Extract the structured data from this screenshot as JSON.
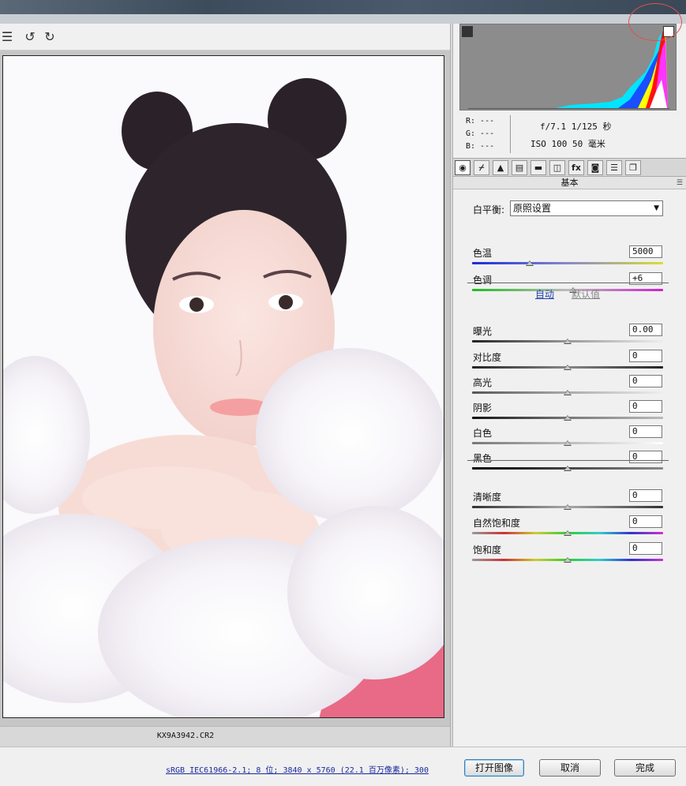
{
  "toolbar": {
    "icons": [
      "list-icon",
      "rotate-left-icon",
      "rotate-right-icon"
    ]
  },
  "image": {
    "filename": "KX9A3942.CR2"
  },
  "readout": {
    "r": "R:  ---",
    "g": "G:  ---",
    "b": "B:  ---",
    "aperture_shutter": "f/7.1  1/125 秒",
    "iso_focal": "ISO 100  50 毫米"
  },
  "tabs": [
    "基本",
    "色调曲线",
    "细节",
    "HSL",
    "分离色调",
    "镜头校正",
    "效果",
    "相机校准",
    "预设",
    "快照"
  ],
  "tab_glyphs": [
    "◉",
    "⌿",
    "▲",
    "▤",
    "▬",
    "◫",
    "fx",
    "◙",
    "☰",
    "❐"
  ],
  "panel": {
    "section_title": "基本",
    "white_balance": {
      "label": "白平衡:",
      "value": "原照设置"
    },
    "auto_link": "自动",
    "default_link": "默认值",
    "sliders": [
      {
        "label": "色温",
        "value": "5000",
        "fill": 0.3
      },
      {
        "label": "色调",
        "value": "+6",
        "fill": 0.53
      },
      {
        "label": "曝光",
        "value": "0.00",
        "fill": 0.5
      },
      {
        "label": "对比度",
        "value": "0",
        "fill": 0.5
      },
      {
        "label": "高光",
        "value": "0",
        "fill": 0.5
      },
      {
        "label": "阴影",
        "value": "0",
        "fill": 0.5
      },
      {
        "label": "白色",
        "value": "0",
        "fill": 0.5
      },
      {
        "label": "黑色",
        "value": "0",
        "fill": 0.5
      },
      {
        "label": "清晰度",
        "value": "0",
        "fill": 0.5
      },
      {
        "label": "自然饱和度",
        "value": "0",
        "fill": 0.5
      },
      {
        "label": "饱和度",
        "value": "0",
        "fill": 0.5
      }
    ]
  },
  "bottom": {
    "info": "sRGB IEC61966-2.1; 8 位; 3840 x 5760 (22.1 百万像素); 300",
    "open_label": "打开图像",
    "cancel_label": "取消",
    "done_label": "完成"
  }
}
